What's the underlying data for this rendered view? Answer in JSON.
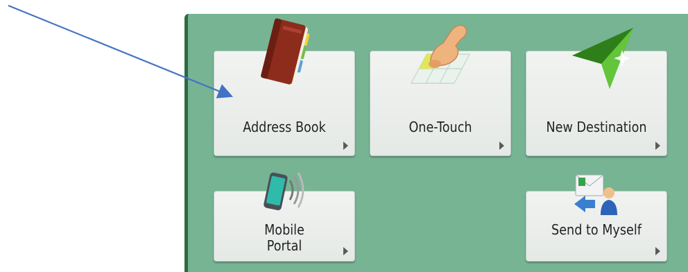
{
  "tiles": {
    "address_book": {
      "label": "Address Book",
      "icon": "address-book-icon"
    },
    "one_touch": {
      "label": "One-Touch",
      "icon": "one-touch-icon"
    },
    "new_destination": {
      "label": "New Destination",
      "icon": "paper-plane-icon"
    },
    "mobile_portal": {
      "label_line1": "Mobile",
      "label_line2": "Portal",
      "icon": "mobile-phone-icon"
    },
    "send_to_myself": {
      "label": "Send to Myself",
      "icon": "send-to-myself-icon"
    }
  },
  "colors": {
    "panel": "#76b494",
    "panel_edge": "#2c6a43",
    "tile": "#e9ece9",
    "annotation_arrow": "#4472c4"
  }
}
